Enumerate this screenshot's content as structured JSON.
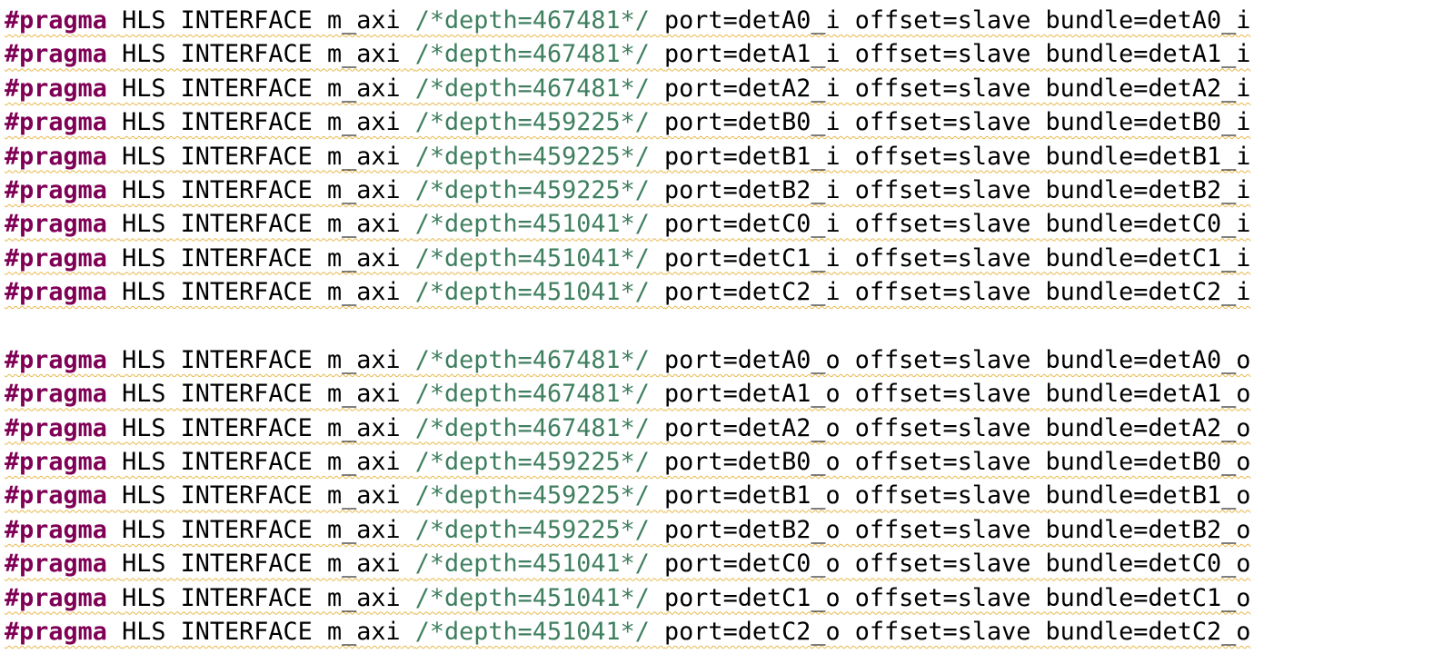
{
  "colors": {
    "keyword": "#7f0055",
    "text": "#000000",
    "comment": "#3f7f5f",
    "squiggle": "#e8b84a",
    "background": "#ffffff"
  },
  "editor": {
    "keyword": "#pragma",
    "directive": "HLS INTERFACE m_axi",
    "lines": [
      {
        "depth": "/*depth=467481*/",
        "rest": "port=detA0_i offset=slave bundle=detA0_i"
      },
      {
        "depth": "/*depth=467481*/",
        "rest": "port=detA1_i offset=slave bundle=detA1_i"
      },
      {
        "depth": "/*depth=467481*/",
        "rest": "port=detA2_i offset=slave bundle=detA2_i"
      },
      {
        "depth": "/*depth=459225*/",
        "rest": "port=detB0_i offset=slave bundle=detB0_i"
      },
      {
        "depth": "/*depth=459225*/",
        "rest": "port=detB1_i offset=slave bundle=detB1_i"
      },
      {
        "depth": "/*depth=459225*/",
        "rest": "port=detB2_i offset=slave bundle=detB2_i"
      },
      {
        "depth": "/*depth=451041*/",
        "rest": "port=detC0_i offset=slave bundle=detC0_i"
      },
      {
        "depth": "/*depth=451041*/",
        "rest": "port=detC1_i offset=slave bundle=detC1_i"
      },
      {
        "depth": "/*depth=451041*/",
        "rest": "port=detC2_i offset=slave bundle=detC2_i"
      },
      {
        "depth": "/*depth=467481*/",
        "rest": "port=detA0_o offset=slave bundle=detA0_o"
      },
      {
        "depth": "/*depth=467481*/",
        "rest": "port=detA1_o offset=slave bundle=detA1_o"
      },
      {
        "depth": "/*depth=467481*/",
        "rest": "port=detA2_o offset=slave bundle=detA2_o"
      },
      {
        "depth": "/*depth=459225*/",
        "rest": "port=detB0_o offset=slave bundle=detB0_o"
      },
      {
        "depth": "/*depth=459225*/",
        "rest": "port=detB1_o offset=slave bundle=detB1_o"
      },
      {
        "depth": "/*depth=459225*/",
        "rest": "port=detB2_o offset=slave bundle=detB2_o"
      },
      {
        "depth": "/*depth=451041*/",
        "rest": "port=detC0_o offset=slave bundle=detC0_o"
      },
      {
        "depth": "/*depth=451041*/",
        "rest": "port=detC1_o offset=slave bundle=detC1_o"
      },
      {
        "depth": "/*depth=451041*/",
        "rest": "port=detC2_o offset=slave bundle=detC2_o"
      }
    ]
  }
}
